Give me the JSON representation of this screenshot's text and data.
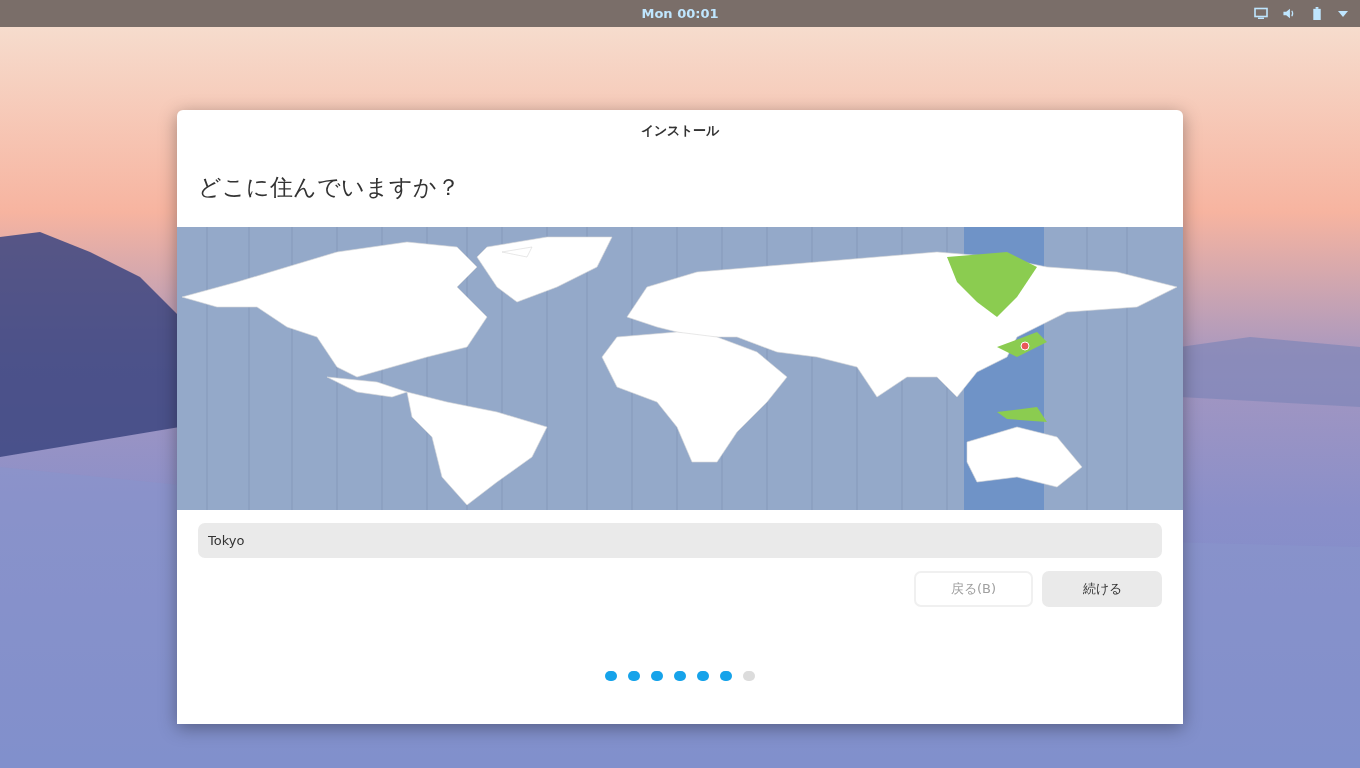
{
  "top_bar": {
    "clock": "Mon 00:01"
  },
  "window": {
    "title": "インストール"
  },
  "heading": "どこに住んでいますか？",
  "location_field": {
    "value": "Tokyo"
  },
  "buttons": [
    {
      "label": "戻る(B)",
      "kind": "back",
      "disabled": true
    },
    {
      "label": "続ける",
      "kind": "continue",
      "disabled": false
    }
  ],
  "progress_steps": [
    {
      "done": true
    },
    {
      "done": true
    },
    {
      "done": true
    },
    {
      "done": true
    },
    {
      "done": true
    },
    {
      "done": true
    },
    {
      "done": false
    }
  ]
}
